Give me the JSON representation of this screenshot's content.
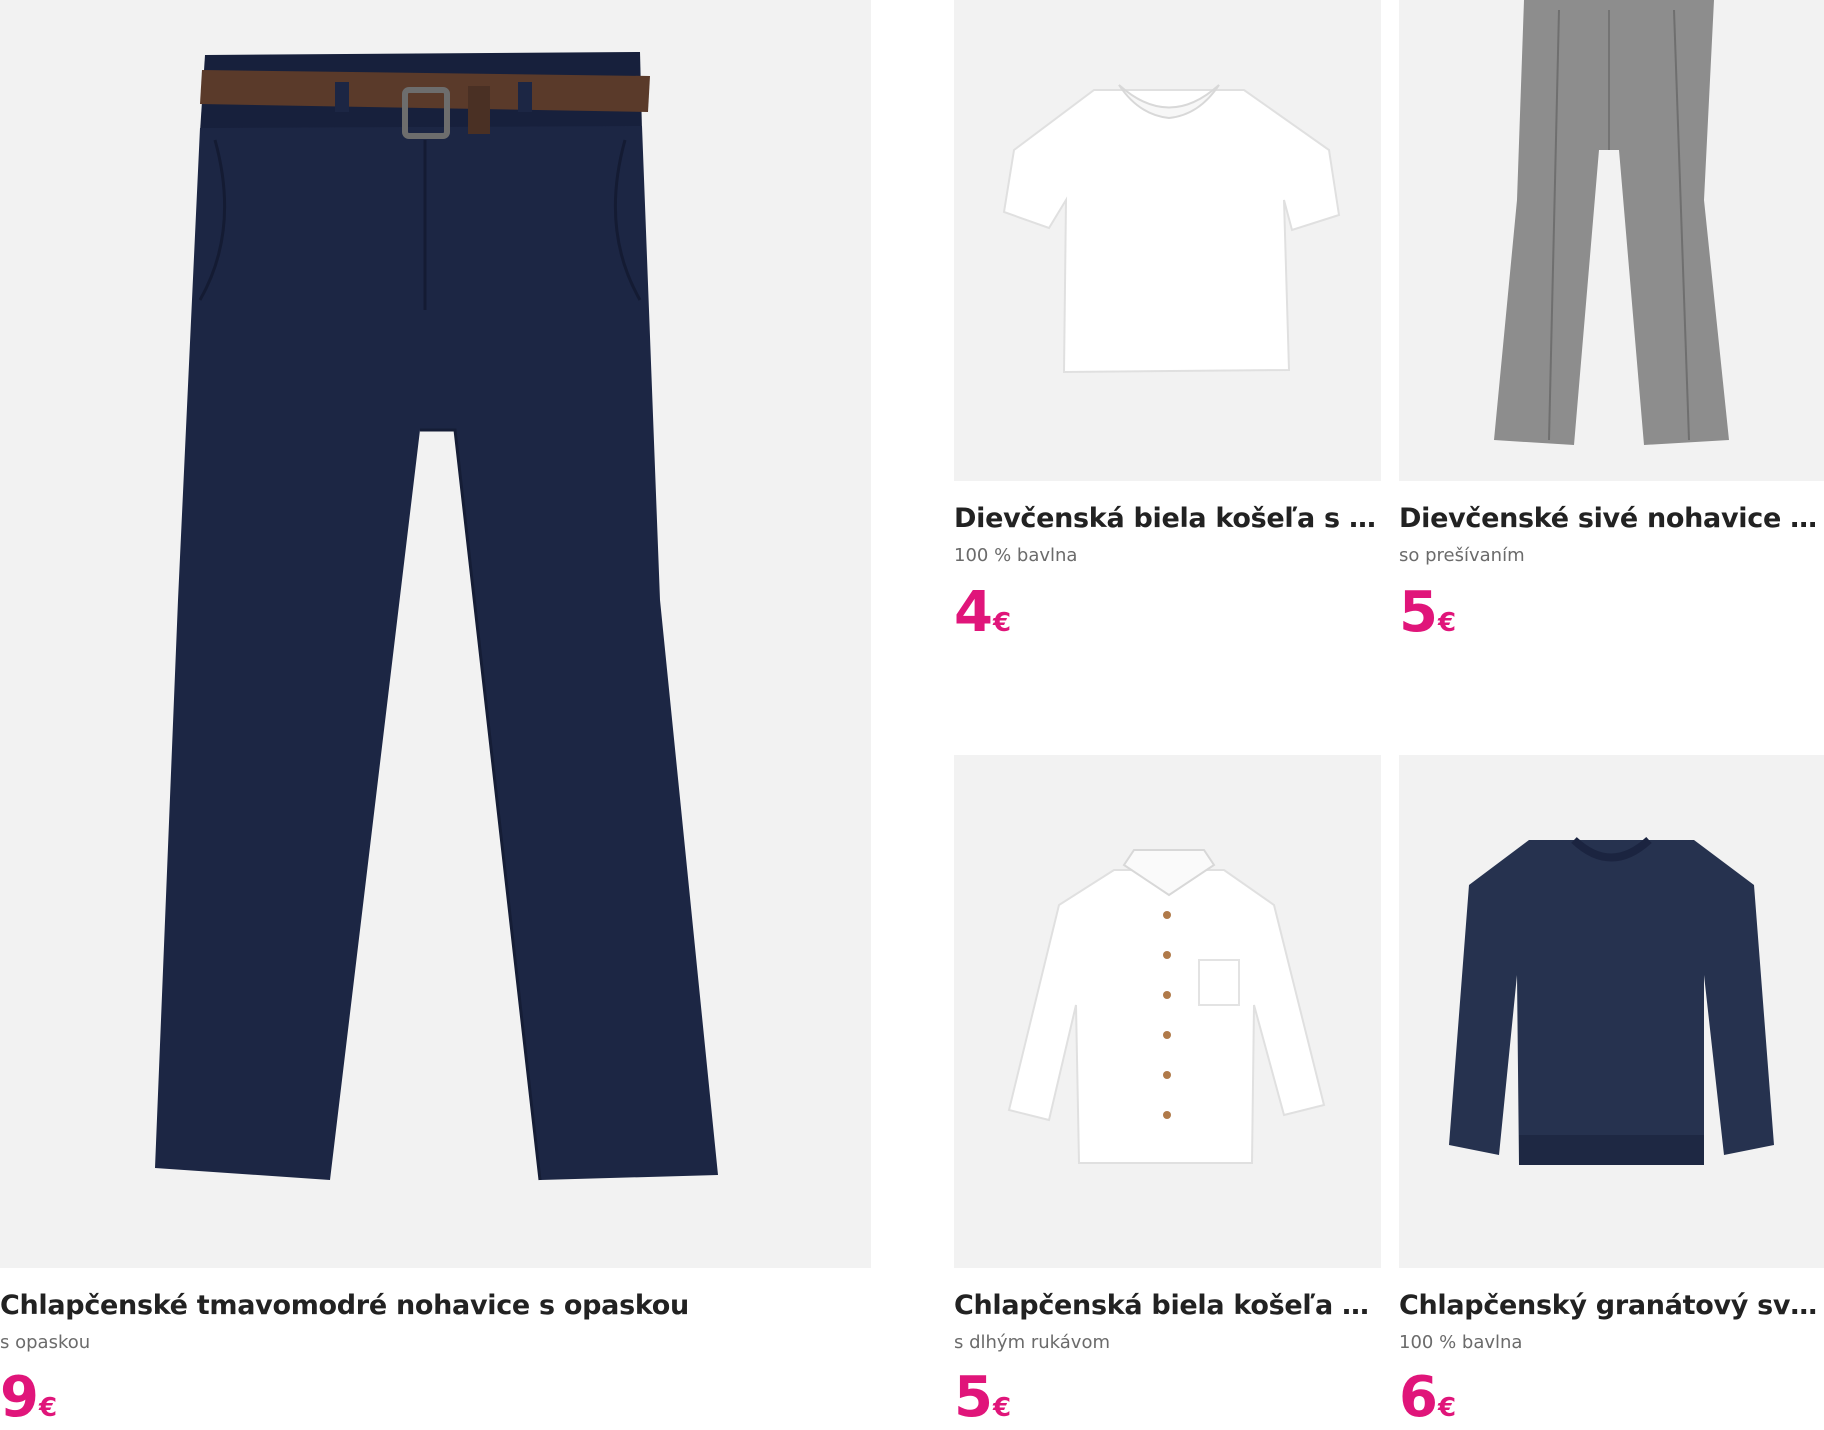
{
  "products": [
    {
      "name": "Chlapčenské tmavomodré nohavice s opaskou",
      "subtitle": "s opaskou",
      "price": "9",
      "currency": "€",
      "image_icon": "navy-trousers-with-belt-image"
    },
    {
      "name": "Dievčenská biela košeľa s čipk...",
      "subtitle": "100 % bavlna",
      "price": "4",
      "currency": "€",
      "image_icon": "white-blouse-image"
    },
    {
      "name": "Dievčenské sivé nohavice s pu...",
      "subtitle": "so prešívaním",
      "price": "5",
      "currency": "€",
      "image_icon": "grey-flared-trousers-image"
    },
    {
      "name": "Chlapčenská biela košeľa s dl...",
      "subtitle": "s dlhým rukávom",
      "price": "5",
      "currency": "€",
      "image_icon": "white-long-sleeve-shirt-image"
    },
    {
      "name": "Chlapčenský granátový svete...",
      "subtitle": "100 % bavlna",
      "price": "6",
      "currency": "€",
      "image_icon": "navy-sweater-image"
    }
  ],
  "colors": {
    "price": "#e0157a",
    "image_bg": "#f2f2f2",
    "navy": "#1b2340",
    "grey": "#8d8d8d"
  }
}
